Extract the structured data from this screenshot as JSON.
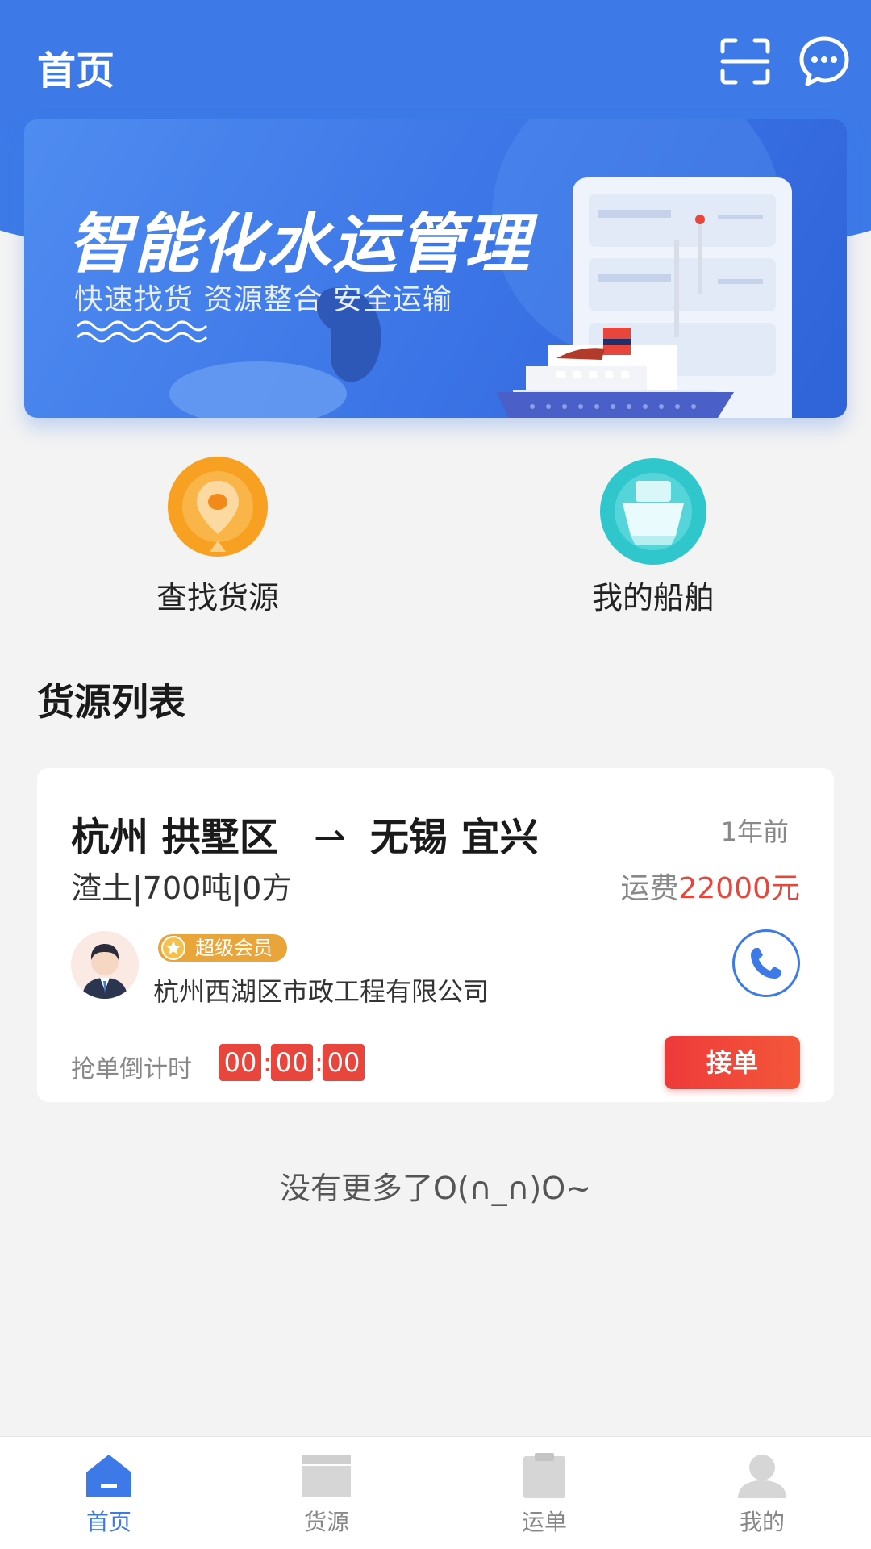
{
  "header": {
    "title": "首页",
    "scan_icon": "scan-icon",
    "message_icon": "message-icon"
  },
  "banner": {
    "title": "智能化水运管理",
    "subtitle": "快速找货 资源整合 安全运输"
  },
  "quick_actions": [
    {
      "label": "查找货源",
      "icon": "location-pin-icon",
      "color": "#f7a021"
    },
    {
      "label": "我的船舶",
      "icon": "ship-icon",
      "color": "#2fc6cc"
    }
  ],
  "section_title": "货源列表",
  "cargo_list": [
    {
      "origin": "杭州 拱墅区",
      "arrow": "⇀",
      "destination": "无锡 宜兴",
      "time_ago": "1年前",
      "cargo": "渣土|700吨|0方",
      "fee_label": "运费",
      "fee_amount": "22000元",
      "badge": "超级会员",
      "company": "杭州西湖区市政工程有限公司",
      "countdown_label": "抢单倒计时",
      "countdown": [
        "00",
        "00",
        "00"
      ],
      "countdown_sep": ":",
      "accept_label": "接单"
    }
  ],
  "footer_text": "没有更多了O(∩_∩)O~",
  "tabs": [
    {
      "label": "首页",
      "icon": "home-icon",
      "active": true
    },
    {
      "label": "货源",
      "icon": "cargo-box-icon",
      "active": false
    },
    {
      "label": "运单",
      "icon": "waybill-icon",
      "active": false
    },
    {
      "label": "我的",
      "icon": "user-icon",
      "active": false
    }
  ],
  "colors": {
    "primary": "#3d7ae8",
    "accent_red": "#e8453c",
    "badge_gold": "#e9a43a",
    "background": "#f3f3f3"
  }
}
